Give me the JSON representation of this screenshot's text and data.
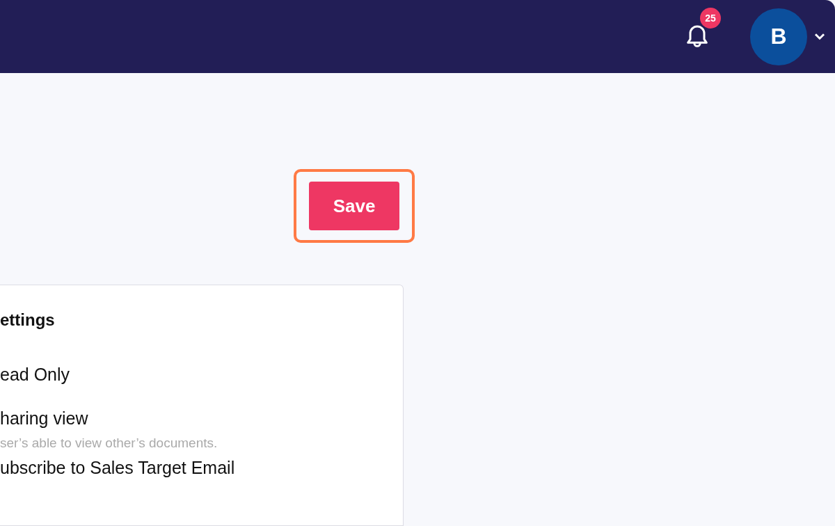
{
  "header": {
    "notifications": {
      "count": "25"
    },
    "avatar": {
      "initial": "B"
    }
  },
  "save_button": {
    "label": "Save",
    "highlighted": true
  },
  "settings_card": {
    "title": "ettings",
    "items": [
      {
        "label": "ead Only"
      },
      {
        "label": "haring view",
        "description": "ser’s able to view other’s documents."
      },
      {
        "label": "ubscribe to Sales Target Email"
      }
    ]
  }
}
